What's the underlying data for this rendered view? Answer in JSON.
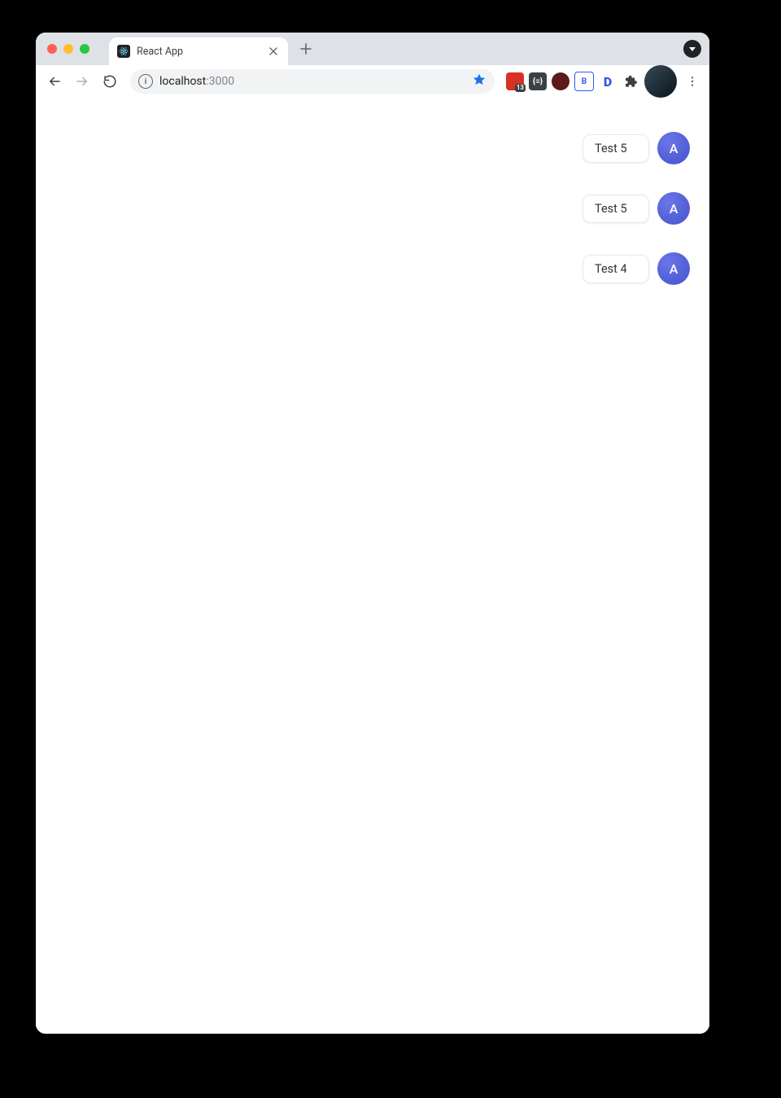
{
  "window": {
    "traffic_lights": [
      "close",
      "minimize",
      "zoom"
    ]
  },
  "tab": {
    "title": "React App",
    "favicon_name": "react-icon"
  },
  "toolbar": {
    "back_enabled": true,
    "forward_enabled": false,
    "site_info_glyph": "i",
    "url_host": "localhost",
    "url_port": ":3000",
    "bookmark_starred": true
  },
  "extensions": [
    {
      "name": "ext-red",
      "label": "",
      "badge": "13"
    },
    {
      "name": "ext-braces",
      "label": "{≡}"
    },
    {
      "name": "ext-round-maroon",
      "label": ""
    },
    {
      "name": "ext-bi",
      "label": "B"
    },
    {
      "name": "ext-d",
      "label": "D"
    },
    {
      "name": "ext-puzzle",
      "label": ""
    },
    {
      "name": "ext-avatar",
      "label": ""
    },
    {
      "name": "ext-menu",
      "label": ""
    }
  ],
  "messages": [
    {
      "text": "Test 5",
      "avatar_initial": "A"
    },
    {
      "text": "Test 5",
      "avatar_initial": "A"
    },
    {
      "text": "Test 4",
      "avatar_initial": "A"
    }
  ]
}
